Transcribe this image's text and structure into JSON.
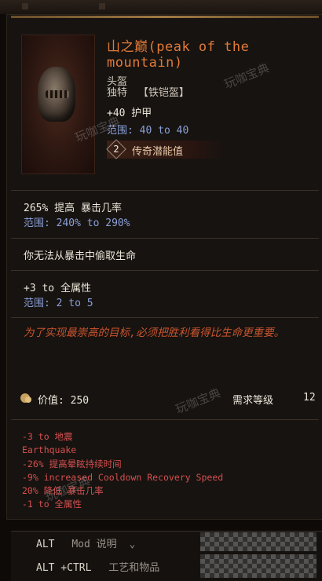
{
  "item": {
    "name": "山之巅(peak of the mountain)",
    "slot": "头盔",
    "rarity": "独特",
    "base": "【铁铠盔】",
    "armor": "+40 护甲",
    "armor_range": "范围: 40 to 40",
    "legendary_potential": "2",
    "legendary_label": "传奇潜能值"
  },
  "affixes": [
    {
      "text": "265% 提高 暴击几率",
      "range": "范围: 240% to 290%"
    },
    {
      "text": "你无法从暴击中偷取生命"
    },
    {
      "text": "+3 to 全属性",
      "range": "范围: 2 to 5"
    }
  ],
  "flavor": "为了实现最崇高的目标,必须把胜利看得比生命更重要。",
  "value": {
    "label": "价值: 250"
  },
  "requirement": {
    "label": "需求等级",
    "level": "12"
  },
  "mods": [
    "-3 to 地震",
    "Earthquake",
    "-26% 提高晕眩持续时间",
    "-9% increased Cooldown Recovery Speed",
    "20% 降低 暴击几率",
    "-1 to 全属性"
  ],
  "keys": {
    "row1_key": "ALT",
    "row1_label": "Mod 说明",
    "row1_chevron": "⌄",
    "row2_key": "ALT +CTRL",
    "row2_label": "工艺和物品"
  },
  "watermark": "玩咖宝典",
  "colors": {
    "unique_name": "#e07a38",
    "range_text": "#8aa0d8",
    "flavor_text": "#c8552e",
    "mod_text": "#d45050"
  }
}
